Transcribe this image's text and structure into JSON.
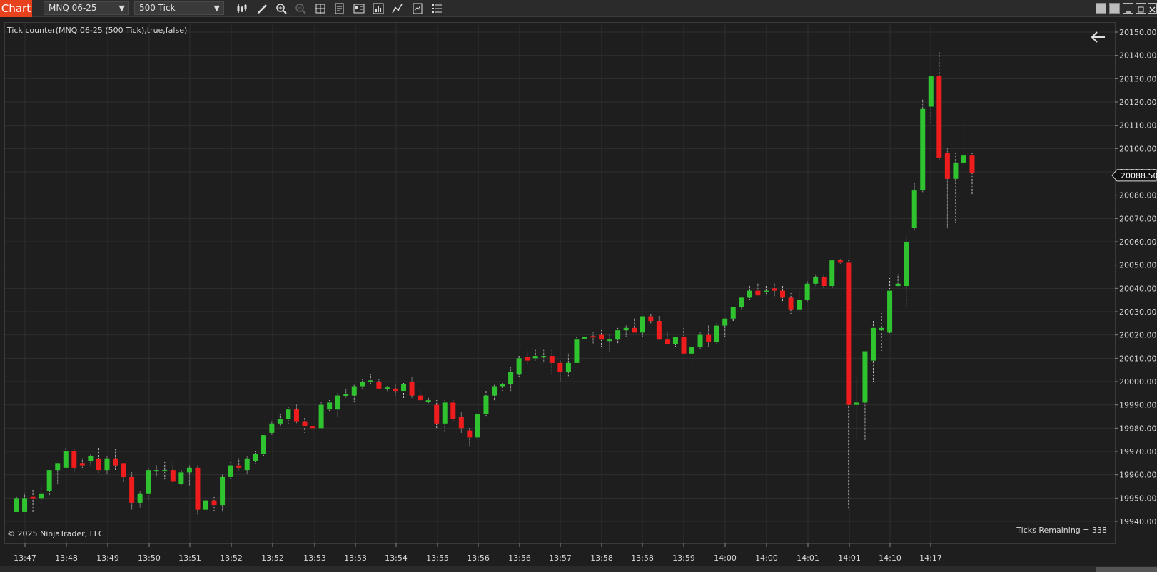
{
  "app": {
    "tab_label": "Chart",
    "instrument": "MNQ 06-25",
    "interval": "500 Tick"
  },
  "toolbar_icons": [
    "bar-type-icon",
    "draw-tool-icon",
    "zoom-in-icon",
    "zoom-out-icon",
    "crosshair-icon",
    "data-box-icon",
    "chart-trader-icon",
    "properties-icon",
    "indicators-icon",
    "strategies-icon",
    "templates-icon"
  ],
  "window_controls": [
    "tile-icon",
    "layout-icon",
    "minimize-icon",
    "restore-icon",
    "close-icon"
  ],
  "chart": {
    "indicator_label": "Tick counter(MNQ 06-25 (500 Tick),true,false)",
    "copyright": "© 2025 NinjaTrader, LLC",
    "ticks_remaining": "Ticks Remaining = 338",
    "back_icon": "arrow-left-icon",
    "last_price_label": "20088.50",
    "colors": {
      "up": "#2fc42f",
      "down": "#ee1c1c",
      "wick": "#cfcfcf",
      "grid": "#2f2f2f",
      "bg": "#1e1e1e"
    }
  },
  "chart_data": {
    "type": "candlestick",
    "ylim": [
      19935,
      20155
    ],
    "y_ticks": [
      "20150.00",
      "20140.00",
      "20130.00",
      "20120.00",
      "20110.00",
      "20100.00",
      "20090.00",
      "20080.00",
      "20070.00",
      "20060.00",
      "20050.00",
      "20040.00",
      "20030.00",
      "20020.00",
      "20010.00",
      "20000.00",
      "19990.00",
      "19980.00",
      "19970.00",
      "19960.00",
      "19950.00",
      "19940.00"
    ],
    "x_ticks": [
      "13:47",
      "13:48",
      "13:49",
      "13:50",
      "13:51",
      "13:52",
      "13:52",
      "13:53",
      "13:53",
      "13:54",
      "13:55",
      "13:56",
      "13:56",
      "13:57",
      "13:58",
      "13:58",
      "13:59",
      "14:00",
      "14:00",
      "14:01",
      "14:01",
      "14:10",
      "14:17"
    ],
    "last_price": 20088.5,
    "candles": [
      {
        "o": 19944.0,
        "h": 19951.0,
        "l": 19944.0,
        "c": 19950.0
      },
      {
        "o": 19944.0,
        "h": 19952.0,
        "l": 19944.0,
        "c": 19950.0
      },
      {
        "o": 19950.5,
        "h": 19953.5,
        "l": 19944.0,
        "c": 19950.0
      },
      {
        "o": 19950.0,
        "h": 19955.0,
        "l": 19947.0,
        "c": 19952.0
      },
      {
        "o": 19953.0,
        "h": 19962.0,
        "l": 19951.0,
        "c": 19962.0
      },
      {
        "o": 19962.0,
        "h": 19965.0,
        "l": 19956.0,
        "c": 19965.0
      },
      {
        "o": 19963.0,
        "h": 19971.5,
        "l": 19963.0,
        "c": 19970.0
      },
      {
        "o": 19970.0,
        "h": 19971.0,
        "l": 19961.0,
        "c": 19963.0
      },
      {
        "o": 19965.0,
        "h": 19967.0,
        "l": 19963.0,
        "c": 19964.0
      },
      {
        "o": 19966.0,
        "h": 19969.0,
        "l": 19964.0,
        "c": 19968.0
      },
      {
        "o": 19967.0,
        "h": 19971.5,
        "l": 19961.0,
        "c": 19962.0
      },
      {
        "o": 19962.0,
        "h": 19968.0,
        "l": 19960.0,
        "c": 19967.0
      },
      {
        "o": 19967.0,
        "h": 19971.0,
        "l": 19962.0,
        "c": 19964.0
      },
      {
        "o": 19965.0,
        "h": 19964.0,
        "l": 19957.0,
        "c": 19959.0
      },
      {
        "o": 19959.0,
        "h": 19961.0,
        "l": 19945.0,
        "c": 19948.0
      },
      {
        "o": 19948.0,
        "h": 19953.0,
        "l": 19946.0,
        "c": 19952.0
      },
      {
        "o": 19952.0,
        "h": 19963.0,
        "l": 19949.0,
        "c": 19962.0
      },
      {
        "o": 19962.0,
        "h": 19964.0,
        "l": 19959.0,
        "c": 19962.0
      },
      {
        "o": 19962.0,
        "h": 19966.0,
        "l": 19958.0,
        "c": 19962.0
      },
      {
        "o": 19962.0,
        "h": 19966.0,
        "l": 19958.0,
        "c": 19957.0
      },
      {
        "o": 19956.0,
        "h": 19962.0,
        "l": 19955.0,
        "c": 19961.0
      },
      {
        "o": 19961.0,
        "h": 19964.0,
        "l": 19955.0,
        "c": 19963.0
      },
      {
        "o": 19963.0,
        "h": 19964.0,
        "l": 19943.0,
        "c": 19945.0
      },
      {
        "o": 19945.0,
        "h": 19950.0,
        "l": 19944.0,
        "c": 19949.0
      },
      {
        "o": 19949.0,
        "h": 19951.0,
        "l": 19944.5,
        "c": 19947.0
      },
      {
        "o": 19947.0,
        "h": 19960.0,
        "l": 19944.0,
        "c": 19959.0
      },
      {
        "o": 19959.0,
        "h": 19966.0,
        "l": 19958.0,
        "c": 19964.0
      },
      {
        "o": 19964.0,
        "h": 19967.0,
        "l": 19962.0,
        "c": 19963.0
      },
      {
        "o": 19962.0,
        "h": 19968.0,
        "l": 19960.0,
        "c": 19967.0
      },
      {
        "o": 19966.0,
        "h": 19970.0,
        "l": 19965.0,
        "c": 19969.0
      },
      {
        "o": 19969.0,
        "h": 19977.0,
        "l": 19968.0,
        "c": 19977.0
      },
      {
        "o": 19978.0,
        "h": 19983.0,
        "l": 19977.0,
        "c": 19982.0
      },
      {
        "o": 19982.0,
        "h": 19986.0,
        "l": 19981.0,
        "c": 19984.0
      },
      {
        "o": 19984.0,
        "h": 19989.0,
        "l": 19982.0,
        "c": 19988.0
      },
      {
        "o": 19988.0,
        "h": 19990.0,
        "l": 19982.0,
        "c": 19983.0
      },
      {
        "o": 19983.0,
        "h": 19985.0,
        "l": 19978.0,
        "c": 19981.0
      },
      {
        "o": 19981.0,
        "h": 19984.0,
        "l": 19976.0,
        "c": 19980.0
      },
      {
        "o": 19980.0,
        "h": 19991.0,
        "l": 19980.0,
        "c": 19990.0
      },
      {
        "o": 19988.0,
        "h": 19992.0,
        "l": 19987.0,
        "c": 19991.0
      },
      {
        "o": 19988.0,
        "h": 19995.0,
        "l": 19985.0,
        "c": 19994.0
      },
      {
        "o": 19994.0,
        "h": 19996.5,
        "l": 19993.0,
        "c": 19994.5
      },
      {
        "o": 19994.0,
        "h": 19999.0,
        "l": 19991.0,
        "c": 19998.0
      },
      {
        "o": 19998.0,
        "h": 20001.0,
        "l": 19997.0,
        "c": 20000.0
      },
      {
        "o": 20000.0,
        "h": 20003.0,
        "l": 19999.0,
        "c": 20000.5
      },
      {
        "o": 20000.0,
        "h": 20001.0,
        "l": 19997.0,
        "c": 19997.0
      },
      {
        "o": 19997.0,
        "h": 19998.0,
        "l": 19996.0,
        "c": 19997.5
      },
      {
        "o": 19997.0,
        "h": 19999.0,
        "l": 19994.0,
        "c": 19996.0
      },
      {
        "o": 19996.0,
        "h": 20000.0,
        "l": 19993.0,
        "c": 19999.0
      },
      {
        "o": 20000.0,
        "h": 20002.0,
        "l": 19993.0,
        "c": 19994.0
      },
      {
        "o": 19994.0,
        "h": 19997.0,
        "l": 19992.0,
        "c": 19992.0
      },
      {
        "o": 19992.0,
        "h": 19993.0,
        "l": 19990.5,
        "c": 19992.0
      },
      {
        "o": 19990.0,
        "h": 19992.0,
        "l": 19980.0,
        "c": 19982.0
      },
      {
        "o": 19982.0,
        "h": 19992.0,
        "l": 19978.0,
        "c": 19991.0
      },
      {
        "o": 19991.0,
        "h": 19992.0,
        "l": 19983.0,
        "c": 19984.0
      },
      {
        "o": 19985.0,
        "h": 19987.0,
        "l": 19978.0,
        "c": 19980.0
      },
      {
        "o": 19979.0,
        "h": 19980.0,
        "l": 19972.0,
        "c": 19976.0
      },
      {
        "o": 19976.0,
        "h": 19985.0,
        "l": 19975.0,
        "c": 19986.0
      },
      {
        "o": 19986.0,
        "h": 19996.0,
        "l": 19985.0,
        "c": 19994.0
      },
      {
        "o": 19994.0,
        "h": 19999.0,
        "l": 19992.0,
        "c": 19998.0
      },
      {
        "o": 19998.0,
        "h": 20000.0,
        "l": 19996.0,
        "c": 19999.0
      },
      {
        "o": 19999.0,
        "h": 20006.0,
        "l": 19996.0,
        "c": 20004.0
      },
      {
        "o": 20003.0,
        "h": 20011.0,
        "l": 20002.0,
        "c": 20010.0
      },
      {
        "o": 20010.5,
        "h": 20013.0,
        "l": 20007.0,
        "c": 20009.0
      },
      {
        "o": 20010.0,
        "h": 20014.0,
        "l": 20009.0,
        "c": 20011.0
      },
      {
        "o": 20011.0,
        "h": 20014.0,
        "l": 20008.0,
        "c": 20011.0
      },
      {
        "o": 20011.0,
        "h": 20014.0,
        "l": 20003.0,
        "c": 20008.0
      },
      {
        "o": 20008.0,
        "h": 20009.0,
        "l": 20000.0,
        "c": 20004.0
      },
      {
        "o": 20004.0,
        "h": 20012.0,
        "l": 20002.0,
        "c": 20008.0
      },
      {
        "o": 20008.0,
        "h": 20019.0,
        "l": 20008.0,
        "c": 20018.0
      },
      {
        "o": 20019.0,
        "h": 20022.0,
        "l": 20017.0,
        "c": 20019.0
      },
      {
        "o": 20019.5,
        "h": 20021.0,
        "l": 20016.0,
        "c": 20019.0
      },
      {
        "o": 20020.0,
        "h": 20022.0,
        "l": 20015.0,
        "c": 20018.0
      },
      {
        "o": 20018.0,
        "h": 20020.0,
        "l": 20013.0,
        "c": 20018.0
      },
      {
        "o": 20018.0,
        "h": 20023.0,
        "l": 20016.0,
        "c": 20022.0
      },
      {
        "o": 20022.0,
        "h": 20024.0,
        "l": 20019.0,
        "c": 20023.0
      },
      {
        "o": 20023.0,
        "h": 20027.0,
        "l": 20021.0,
        "c": 20021.0
      },
      {
        "o": 20021.0,
        "h": 20025.0,
        "l": 20019.0,
        "c": 20028.0
      },
      {
        "o": 20028.0,
        "h": 20029.0,
        "l": 20025.0,
        "c": 20026.0
      },
      {
        "o": 20026.0,
        "h": 20028.0,
        "l": 20018.0,
        "c": 20018.0
      },
      {
        "o": 20018.0,
        "h": 20021.0,
        "l": 20016.0,
        "c": 20016.0
      },
      {
        "o": 20016.0,
        "h": 20019.0,
        "l": 20015.0,
        "c": 20019.0
      },
      {
        "o": 20019.0,
        "h": 20023.0,
        "l": 20012.0,
        "c": 20012.0
      },
      {
        "o": 20012.0,
        "h": 20015.0,
        "l": 20006.0,
        "c": 20015.0
      },
      {
        "o": 20015.0,
        "h": 20021.0,
        "l": 20014.0,
        "c": 20020.0
      },
      {
        "o": 20020.0,
        "h": 20024.0,
        "l": 20015.0,
        "c": 20017.0
      },
      {
        "o": 20017.0,
        "h": 20025.0,
        "l": 20016.0,
        "c": 20024.0
      },
      {
        "o": 20024.0,
        "h": 20027.0,
        "l": 20019.0,
        "c": 20027.0
      },
      {
        "o": 20027.0,
        "h": 20030.0,
        "l": 20026.0,
        "c": 20032.0
      },
      {
        "o": 20032.0,
        "h": 20036.0,
        "l": 20031.0,
        "c": 20036.0
      },
      {
        "o": 20036.0,
        "h": 20041.0,
        "l": 20035.0,
        "c": 20039.0
      },
      {
        "o": 20039.0,
        "h": 20042.0,
        "l": 20037.0,
        "c": 20037.0
      },
      {
        "o": 20039.0,
        "h": 20041.0,
        "l": 20037.0,
        "c": 20039.0
      },
      {
        "o": 20040.0,
        "h": 20042.0,
        "l": 20036.0,
        "c": 20039.0
      },
      {
        "o": 20039.0,
        "h": 20041.0,
        "l": 20034.0,
        "c": 20036.0
      },
      {
        "o": 20036.0,
        "h": 20038.0,
        "l": 20029.0,
        "c": 20031.0
      },
      {
        "o": 20031.0,
        "h": 20039.0,
        "l": 20030.0,
        "c": 20035.0
      },
      {
        "o": 20035.0,
        "h": 20043.0,
        "l": 20034.0,
        "c": 20042.0
      },
      {
        "o": 20042.0,
        "h": 20046.0,
        "l": 20041.0,
        "c": 20045.0
      },
      {
        "o": 20045.0,
        "h": 20046.0,
        "l": 20040.0,
        "c": 20041.0
      },
      {
        "o": 20041.0,
        "h": 20052.0,
        "l": 20040.0,
        "c": 20052.0
      },
      {
        "o": 20052.0,
        "h": 20052.5,
        "l": 20050.5,
        "c": 20051.0
      },
      {
        "o": 20051.0,
        "h": 20052.0,
        "l": 19945.0,
        "c": 19990.0
      },
      {
        "o": 19990.0,
        "h": 20002.0,
        "l": 19975.0,
        "c": 19991.0
      },
      {
        "o": 19991.0,
        "h": 20012.0,
        "l": 19975.0,
        "c": 20013.0
      },
      {
        "o": 20009.0,
        "h": 20026.0,
        "l": 20000.0,
        "c": 20023.0
      },
      {
        "o": 20022.0,
        "h": 20030.0,
        "l": 20013.0,
        "c": 20023.0
      },
      {
        "o": 20021.0,
        "h": 20045.0,
        "l": 20020.0,
        "c": 20039.0
      },
      {
        "o": 20041.0,
        "h": 20046.0,
        "l": 20041.0,
        "c": 20042.0
      },
      {
        "o": 20041.0,
        "h": 20063.0,
        "l": 20032.0,
        "c": 20060.0
      },
      {
        "o": 20066.0,
        "h": 20085.0,
        "l": 20065.0,
        "c": 20082.0
      },
      {
        "o": 20082.0,
        "h": 20121.0,
        "l": 20081.0,
        "c": 20117.0
      },
      {
        "o": 20118.0,
        "h": 20131.0,
        "l": 20111.0,
        "c": 20131.0
      },
      {
        "o": 20131.0,
        "h": 20142.0,
        "l": 20095.0,
        "c": 20096.0
      },
      {
        "o": 20098.0,
        "h": 20100.0,
        "l": 20066.0,
        "c": 20087.0
      },
      {
        "o": 20087.0,
        "h": 20098.0,
        "l": 20068.0,
        "c": 20094.0
      },
      {
        "o": 20094.0,
        "h": 20111.0,
        "l": 20092.0,
        "c": 20097.0
      },
      {
        "o": 20097.0,
        "h": 20098.0,
        "l": 20080.0,
        "c": 20089.5
      }
    ]
  }
}
